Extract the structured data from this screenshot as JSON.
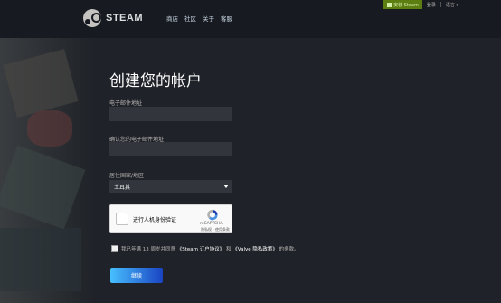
{
  "header": {
    "logo_text": "STEAM",
    "nav": [
      "商店",
      "社区",
      "关于",
      "客服"
    ],
    "install_label": "安装 Steam",
    "login_label": "登录",
    "language_label": "语言"
  },
  "form": {
    "title": "创建您的帐户",
    "email_label": "电子邮件地址",
    "email_value": "",
    "confirm_email_label": "确认您的电子邮件地址",
    "confirm_email_value": "",
    "country_label": "居住国家/地区",
    "country_value": "土耳其",
    "captcha": {
      "text": "进行人机身份验证",
      "brand": "reCAPTCHA",
      "links": "隐私权 - 使用条款"
    },
    "agree": {
      "prefix": "我已年满 13 周岁并同意",
      "ssa": "《Steam 订户协议》",
      "middle": "和",
      "privacy": "《Valve 隐私政策》",
      "suffix": "的条款。"
    },
    "continue_label": "继续"
  },
  "colors": {
    "header_bg": "#171a21",
    "page_bg": "#1f2228",
    "input_bg": "#32353c",
    "install_bg": "#5c7e10",
    "button_gradient_start": "#47bfff",
    "button_gradient_end": "#1a44c2"
  }
}
